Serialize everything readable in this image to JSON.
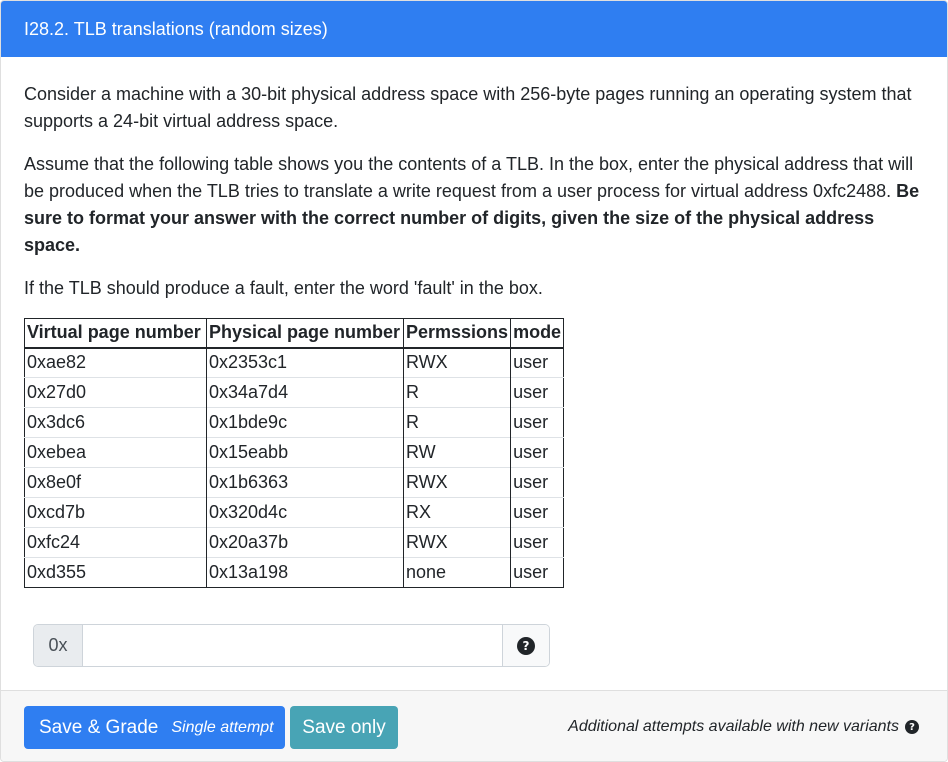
{
  "header": {
    "title": "I28.2. TLB translations (random sizes)"
  },
  "question": {
    "p1": "Consider a machine with a 30-bit physical address space with 256-byte pages running an operating system that supports a 24-bit virtual address space.",
    "p2_text": "Assume that the following table shows you the contents of a TLB. In the box, enter the physical address that will be produced when the TLB tries to translate a write request from a user process for virtual address 0xfc2488. ",
    "p2_bold": "Be sure to format your answer with the correct number of digits, given the size of the physical address space.",
    "p3": "If the TLB should produce a fault, enter the word 'fault' in the box."
  },
  "table": {
    "headers": [
      "Virtual page number",
      "Physical page number",
      "Permssions",
      "mode"
    ],
    "rows": [
      [
        "0xae82",
        "0x2353c1",
        "RWX",
        "user"
      ],
      [
        "0x27d0",
        "0x34a7d4",
        "R",
        "user"
      ],
      [
        "0x3dc6",
        "0x1bde9c",
        "R",
        "user"
      ],
      [
        "0xebea",
        "0x15eabb",
        "RW",
        "user"
      ],
      [
        "0x8e0f",
        "0x1b6363",
        "RWX",
        "user"
      ],
      [
        "0xcd7b",
        "0x320d4c",
        "RX",
        "user"
      ],
      [
        "0xfc24",
        "0x20a37b",
        "RWX",
        "user"
      ],
      [
        "0xd355",
        "0x13a198",
        "none",
        "user"
      ]
    ]
  },
  "answer": {
    "prefix": "0x",
    "value": "",
    "help_icon": "question-circle-icon"
  },
  "footer": {
    "grade_label": "Save & Grade",
    "grade_note": "Single attempt",
    "save_label": "Save only",
    "attempts_text": "Additional attempts available with new variants",
    "info_icon": "question-circle-icon"
  },
  "colors": {
    "header_bg": "#2f7ef1",
    "grade_bg": "#2f7ef1",
    "save_bg": "#48a4b5",
    "footer_bg": "#f7f7f7"
  }
}
